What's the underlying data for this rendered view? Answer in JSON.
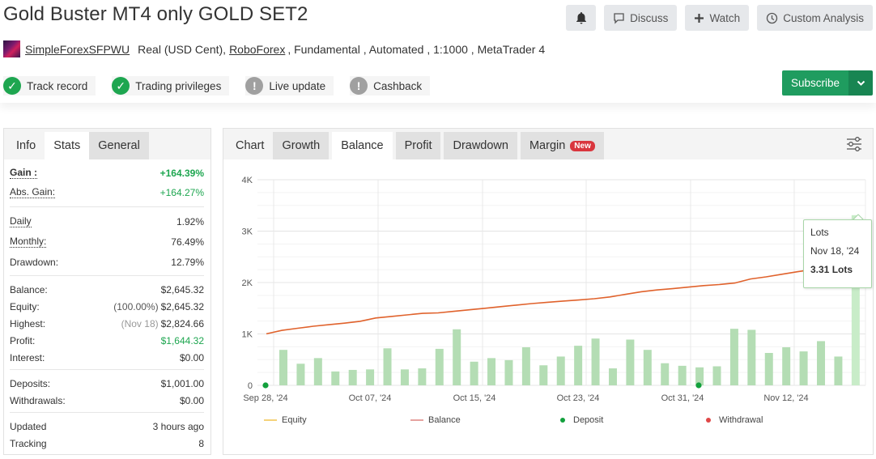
{
  "header": {
    "title": "Gold Buster MT4 only GOLD SET2",
    "actions": {
      "bell_icon": "bell-icon",
      "discuss": "Discuss",
      "watch": "Watch",
      "custom_analysis": "Custom Analysis"
    },
    "meta": {
      "user": "SimpleForexSFPWU",
      "account_type": "Real (USD Cent),",
      "broker": "RoboForex",
      "details": ", Fundamental , Automated , 1:1000 , MetaTrader 4"
    },
    "badges": [
      {
        "label": "Track record",
        "status": "ok"
      },
      {
        "label": "Trading privileges",
        "status": "ok"
      },
      {
        "label": "Live update",
        "status": "warn"
      },
      {
        "label": "Cashback",
        "status": "warn"
      }
    ],
    "subscribe": "Subscribe"
  },
  "left_panel": {
    "tabs": [
      {
        "label": "Info"
      },
      {
        "label": "Stats"
      },
      {
        "label": "General"
      }
    ],
    "stats": {
      "gain": {
        "label": "Gain :",
        "value": "+164.39%"
      },
      "abs_gain": {
        "label": "Abs. Gain:",
        "value": "+164.27%"
      },
      "daily": {
        "label": "Daily",
        "value": "1.92%"
      },
      "monthly": {
        "label": "Monthly:",
        "value": "76.49%"
      },
      "drawdown": {
        "label": "Drawdown:",
        "value": "12.79%"
      },
      "balance": {
        "label": "Balance:",
        "value": "$2,645.32"
      },
      "equity": {
        "label": "Equity:",
        "prefix": "(100.00%)",
        "value": "$2,645.32"
      },
      "highest": {
        "label": "Highest:",
        "prefix": "(Nov 18)",
        "value": "$2,824.66"
      },
      "profit": {
        "label": "Profit:",
        "value": "$1,644.32"
      },
      "interest": {
        "label": "Interest:",
        "value": "$0.00"
      },
      "deposits": {
        "label": "Deposits:",
        "value": "$1,001.00"
      },
      "withdrawals": {
        "label": "Withdrawals:",
        "value": "$0.00"
      },
      "updated": {
        "label": "Updated",
        "value": "3 hours ago"
      },
      "tracking": {
        "label": "Tracking",
        "value": "8"
      }
    }
  },
  "right_panel": {
    "tabs": [
      {
        "label": "Chart"
      },
      {
        "label": "Growth"
      },
      {
        "label": "Balance"
      },
      {
        "label": "Profit"
      },
      {
        "label": "Drawdown"
      },
      {
        "label": "Margin",
        "badge": "New"
      }
    ],
    "active_tab": "Balance",
    "tooltip": {
      "title": "Lots",
      "date": "Nov 18, '24",
      "value": "3.31 Lots"
    }
  },
  "colors": {
    "green": "#1ea650",
    "subscribe": "#1f9c5f",
    "balance_line": "#e0622c",
    "equity_line": "#f5d27a",
    "lots_bar": "#b4ddb4",
    "lots_bar_highlight": "#c8ecc8",
    "deposit": "#12a03c",
    "withdrawal": "#e04848",
    "new_badge": "#d9363e"
  },
  "chart_data": {
    "type": "line+bar",
    "title": "Balance",
    "xlabel": "",
    "ylabel": "",
    "ylim": [
      0,
      4000
    ],
    "yticks": [
      "0",
      "1K",
      "2K",
      "3K",
      "4K"
    ],
    "ytick_values": [
      0,
      1000,
      2000,
      3000,
      4000
    ],
    "xticks": [
      "Sep 28, '24",
      "Oct 07, '24",
      "Oct 15, '24",
      "Oct 23, '24",
      "Oct 31, '24",
      "Nov 12, '24"
    ],
    "grid": true,
    "legend": [
      "Equity",
      "Balance",
      "Deposit",
      "Withdrawal"
    ],
    "legend_position": "bottom",
    "series": [
      {
        "name": "Balance",
        "type": "line",
        "values": [
          1001,
          1070,
          1110,
          1150,
          1180,
          1210,
          1245,
          1310,
          1340,
          1370,
          1400,
          1410,
          1440,
          1470,
          1500,
          1530,
          1560,
          1590,
          1615,
          1640,
          1660,
          1685,
          1720,
          1770,
          1820,
          1855,
          1880,
          1910,
          1940,
          1960,
          1990,
          2070,
          2110,
          2160,
          2210,
          2255,
          2300,
          2340,
          2400
        ]
      },
      {
        "name": "Lots",
        "type": "bar",
        "unit": "Lots",
        "values": [
          0.69,
          0.42,
          0.53,
          0.27,
          0.3,
          0.31,
          0.72,
          0.31,
          0.33,
          0.71,
          1.09,
          0.46,
          0.53,
          0.49,
          0.74,
          0.39,
          0.56,
          0.77,
          0.91,
          0.33,
          0.89,
          0.69,
          0.43,
          0.38,
          0.35,
          0.37,
          1.1,
          1.08,
          0.63,
          0.74,
          0.66,
          0.86,
          0.56,
          3.31
        ],
        "highlighted": {
          "date": "Nov 18, '24",
          "value": 3.31
        }
      },
      {
        "name": "Deposit",
        "type": "marker",
        "points": [
          {
            "date": "Sep 28, '24",
            "value": 0
          },
          {
            "date": "Nov 01, '24",
            "value": 0
          }
        ]
      }
    ]
  }
}
